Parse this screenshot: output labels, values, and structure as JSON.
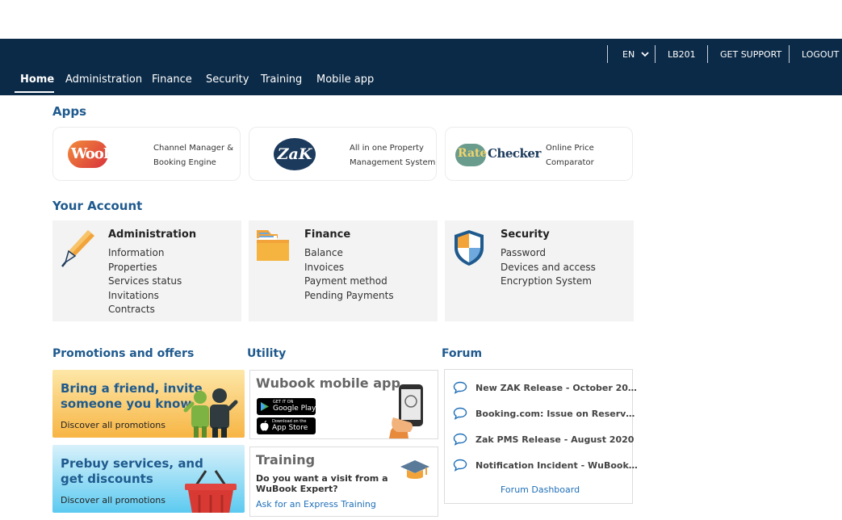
{
  "topbar": {
    "language": "EN",
    "account": "LB201",
    "support": "GET SUPPORT",
    "logout": "LOGOUT"
  },
  "nav": {
    "home": "Home",
    "administration": "Administration",
    "finance": "Finance",
    "security": "Security",
    "training": "Training",
    "mobile_app": "Mobile app"
  },
  "apps": {
    "title": "Apps",
    "items": [
      {
        "logo": "WooDoo",
        "desc_line1": "Channel Manager &",
        "desc_line2": "Booking Engine"
      },
      {
        "logo": "ZaK",
        "desc_line1": "All in one Property",
        "desc_line2": "Management System"
      },
      {
        "logo": "Rate Checker",
        "logo_part1": "Rate",
        "logo_part2": "Checker",
        "desc_line1": "Online Price",
        "desc_line2": "Comparator"
      }
    ]
  },
  "account": {
    "title": "Your Account",
    "cards": [
      {
        "title": "Administration",
        "icon": "pen-icon",
        "links": [
          "Information",
          "Properties",
          "Services status",
          "Invitations",
          "Contracts"
        ]
      },
      {
        "title": "Finance",
        "icon": "folder-icon",
        "links": [
          "Balance",
          "Invoices",
          "Payment method",
          "Pending Payments"
        ]
      },
      {
        "title": "Security",
        "icon": "shield-icon",
        "links": [
          "Password",
          "Devices and access",
          "Encryption System"
        ]
      }
    ]
  },
  "promotions": {
    "title": "Promotions and offers",
    "items": [
      {
        "line1": "Bring a friend, invite",
        "line2": "someone you know",
        "link": "Discover all promotions"
      },
      {
        "line1": "Prebuy services, and",
        "line2": "get discounts",
        "link": "Discover all promotions"
      }
    ]
  },
  "utility": {
    "title": "Utility",
    "mobile": {
      "title": "Wubook mobile app",
      "google_small": "GET IT ON",
      "google_big": "Google Play",
      "apple_small": "Download on the",
      "apple_big": "App Store"
    },
    "training": {
      "title": "Training",
      "line1": "Do you want a visit from a",
      "line2": "WuBook Expert?",
      "link": "Ask for an Express Training"
    }
  },
  "forum": {
    "title": "Forum",
    "items": [
      "New ZAK Release - October 20…",
      "Booking.com: Issue on Reserv…",
      "Zak PMS Release - August 2020",
      "Notification Incident - WuBook…"
    ],
    "dashboard": "Forum Dashboard"
  },
  "colors": {
    "topbar": "#0b2a47",
    "section_title": "#1f5a8e",
    "link": "#1f6fb8"
  }
}
